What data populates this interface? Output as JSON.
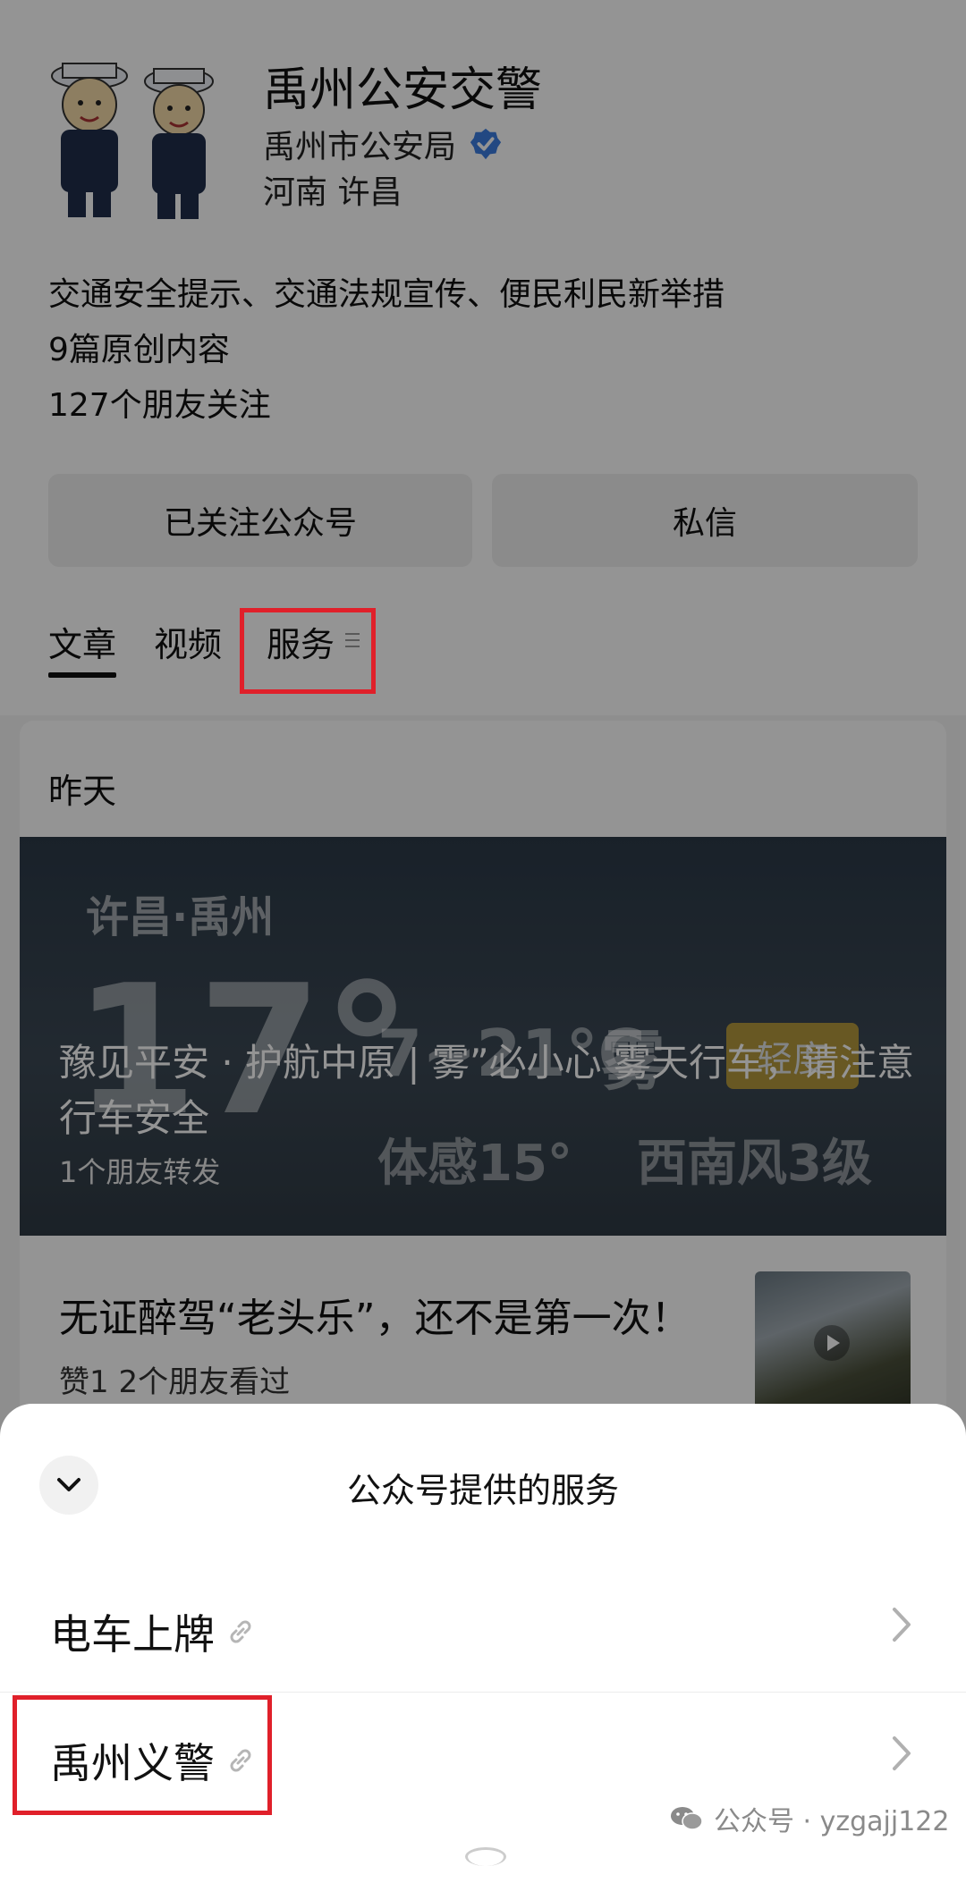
{
  "profile": {
    "name": "禹州公安交警",
    "owner": "禹州市公安局",
    "location": "河南 许昌",
    "desc": [
      "交通安全提示、交通法规宣传、便民利民新举措",
      "9篇原创内容",
      "127个朋友关注"
    ],
    "follow_button": "已关注公众号",
    "message_button": "私信"
  },
  "tabs": {
    "articles": "文章",
    "videos": "视频",
    "services": "服务"
  },
  "feed": {
    "date": "昨天",
    "hero": {
      "loc": "许昌·禹州",
      "temp": "17°",
      "range": "7~21°C",
      "fog": "雾",
      "badge": "轻度",
      "feel": "体感15°",
      "wind": "西南风3级",
      "title": "豫见平安 · 护航中原 | 雾”必小心 雾天行车，请注意行车安全",
      "share": "1个朋友转发"
    },
    "item2": {
      "title": "无证醉驾“老头乐”，还不是第一次！",
      "meta": "赞1  2个朋友看过"
    }
  },
  "sheet": {
    "title": "公众号提供的服务",
    "services": [
      {
        "label": "电车上牌"
      },
      {
        "label": "禹州义警"
      }
    ]
  },
  "watermark": "公众号 · yzgajj122",
  "colors": {
    "highlight": "#e0202a",
    "verify": "#3b7de0"
  }
}
